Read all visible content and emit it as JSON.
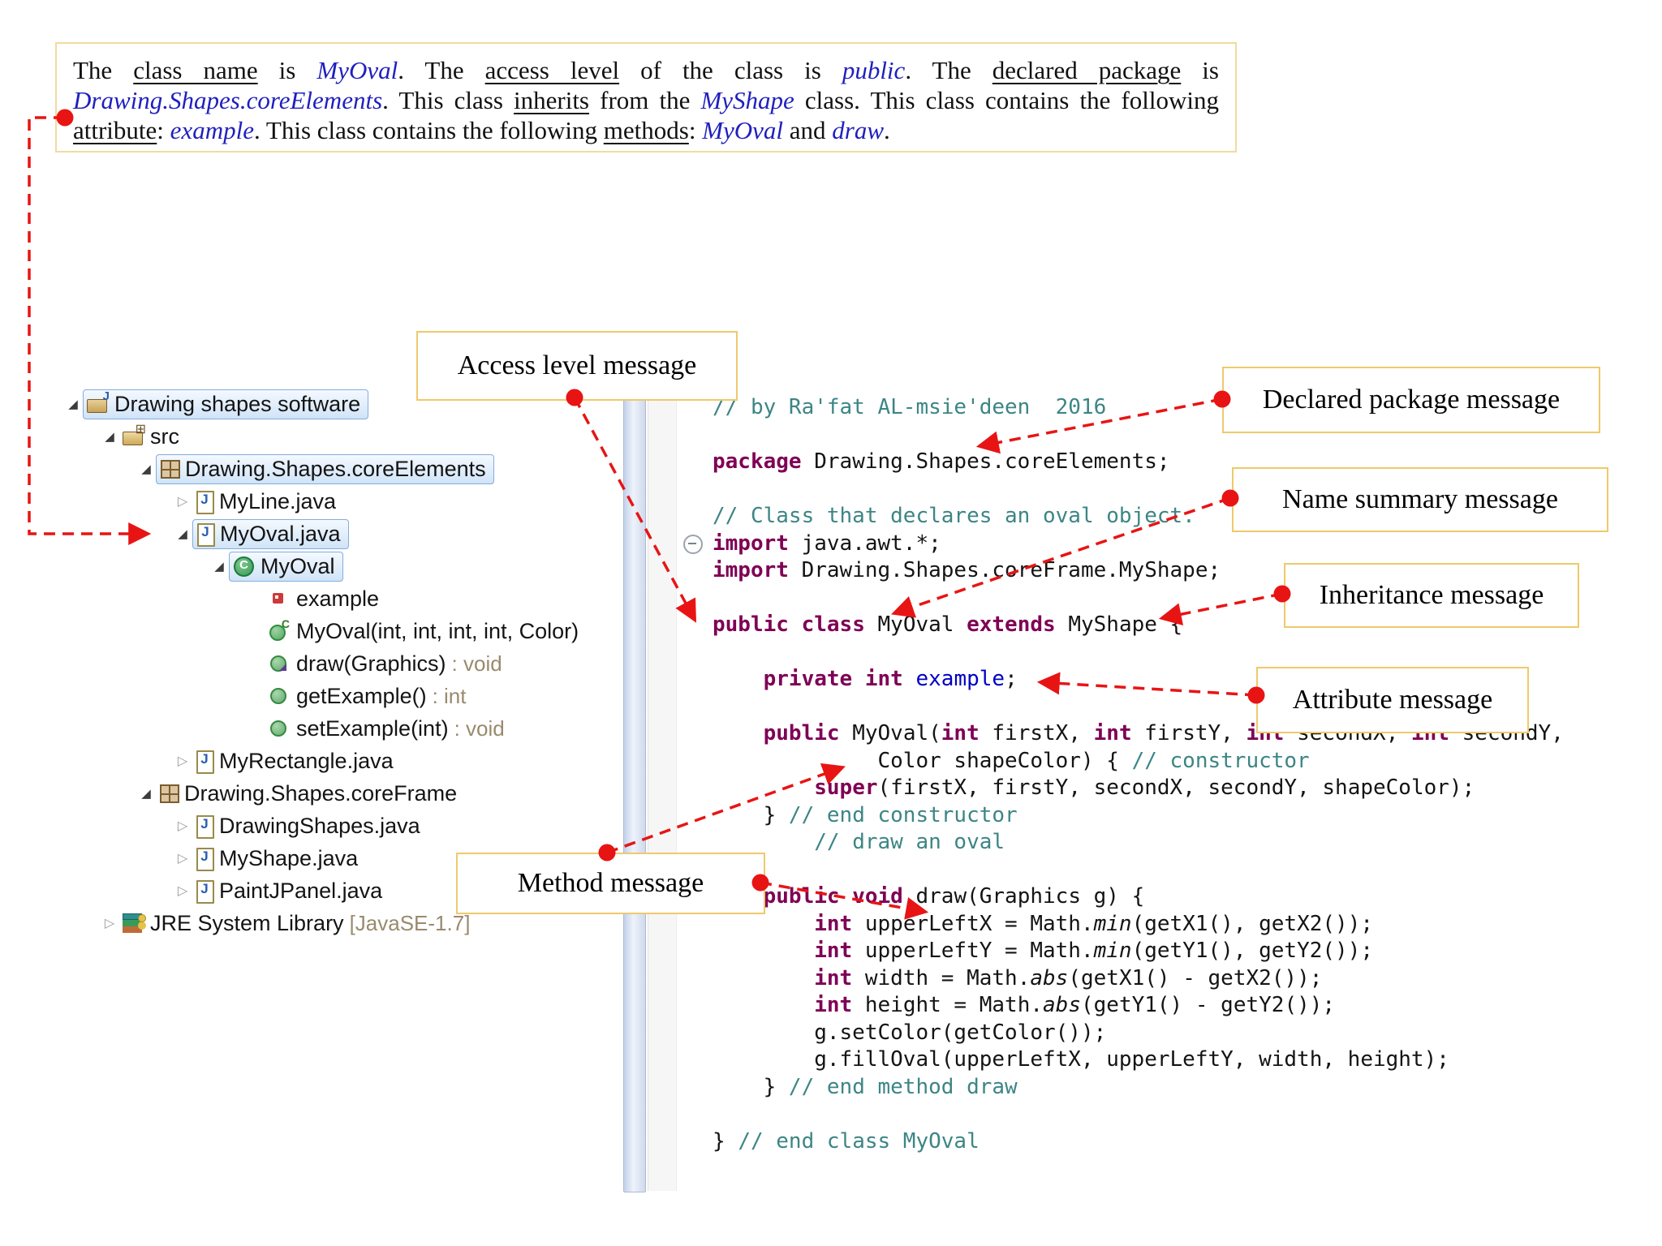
{
  "summary": {
    "segments": [
      {
        "t": "The ",
        "s": "p"
      },
      {
        "t": "class name",
        "s": "u"
      },
      {
        "t": " is ",
        "s": "p"
      },
      {
        "t": "MyOval",
        "s": "b"
      },
      {
        "t": ". The ",
        "s": "p"
      },
      {
        "t": "access level",
        "s": "u"
      },
      {
        "t": " of the class is ",
        "s": "p"
      },
      {
        "t": "public",
        "s": "b"
      },
      {
        "t": ". The ",
        "s": "p"
      },
      {
        "t": "declared package",
        "s": "u"
      },
      {
        "t": " is ",
        "s": "p"
      },
      {
        "t": "Drawing.Shapes.coreElements",
        "s": "b"
      },
      {
        "t": ". This class ",
        "s": "p"
      },
      {
        "t": "inherits",
        "s": "u"
      },
      {
        "t": " from the ",
        "s": "p"
      },
      {
        "t": "MyShape",
        "s": "b"
      },
      {
        "t": " class. This class contains the following ",
        "s": "p"
      },
      {
        "t": "attribute",
        "s": "u"
      },
      {
        "t": ": ",
        "s": "p"
      },
      {
        "t": "example",
        "s": "b"
      },
      {
        "t": ". This class contains the following ",
        "s": "p"
      },
      {
        "t": "methods",
        "s": "u"
      },
      {
        "t": ": ",
        "s": "p"
      },
      {
        "t": "MyOval",
        "s": "b"
      },
      {
        "t": " and ",
        "s": "p"
      },
      {
        "t": "draw",
        "s": "b"
      },
      {
        "t": ".",
        "s": "p"
      }
    ]
  },
  "explorer": {
    "rows": [
      {
        "level": 0,
        "arrow": "exp",
        "icon": "java-project",
        "label": "Drawing shapes software",
        "selected": true
      },
      {
        "level": 1,
        "arrow": "exp",
        "icon": "source-folder",
        "label": "src",
        "selected": false
      },
      {
        "level": 2,
        "arrow": "exp",
        "icon": "package",
        "label": "Drawing.Shapes.coreElements",
        "selected": true
      },
      {
        "level": 3,
        "arrow": "col",
        "icon": "java-file",
        "label": "MyLine.java",
        "selected": false
      },
      {
        "level": 3,
        "arrow": "exp",
        "icon": "java-file",
        "label": "MyOval.java",
        "selected": true
      },
      {
        "level": 4,
        "arrow": "exp",
        "icon": "class",
        "label": "MyOval",
        "selected": true
      },
      {
        "level": 5,
        "arrow": null,
        "icon": "private-field",
        "label": "example",
        "selected": false
      },
      {
        "level": 5,
        "arrow": null,
        "icon": "constructor",
        "label": "MyOval(int, int, int, int, Color)",
        "selected": false
      },
      {
        "level": 5,
        "arrow": null,
        "icon": "override-method",
        "label": "draw(Graphics)",
        "suffix": " : void",
        "selected": false
      },
      {
        "level": 5,
        "arrow": null,
        "icon": "method",
        "label": "getExample()",
        "suffix": " : int",
        "selected": false
      },
      {
        "level": 5,
        "arrow": null,
        "icon": "method",
        "label": "setExample(int)",
        "suffix": " : void",
        "selected": false
      },
      {
        "level": 3,
        "arrow": "col",
        "icon": "java-file",
        "label": "MyRectangle.java",
        "selected": false
      },
      {
        "level": 2,
        "arrow": "exp",
        "icon": "package",
        "label": "Drawing.Shapes.coreFrame",
        "selected": false
      },
      {
        "level": 3,
        "arrow": "col",
        "icon": "java-file",
        "label": "DrawingShapes.java",
        "selected": false
      },
      {
        "level": 3,
        "arrow": "col",
        "icon": "java-file",
        "label": "MyShape.java",
        "selected": false
      },
      {
        "level": 3,
        "arrow": "col",
        "icon": "java-file",
        "label": "PaintJPanel.java",
        "selected": false
      },
      {
        "level": 1,
        "arrow": "col",
        "icon": "jre-library",
        "label": "JRE System Library",
        "suffix": " [JavaSE-1.7]",
        "selected": false
      }
    ]
  },
  "editor": {
    "lines": [
      {
        "tokens": [
          [
            "c",
            "// by Ra'fat AL-msie'deen  2016"
          ]
        ]
      },
      {
        "tokens": []
      },
      {
        "tokens": [
          [
            "k",
            "package"
          ],
          [
            "p",
            " Drawing.Shapes.coreElements;"
          ]
        ]
      },
      {
        "tokens": []
      },
      {
        "tokens": [
          [
            "c",
            "// Class that declares an oval object."
          ]
        ]
      },
      {
        "tokens": [
          [
            "k",
            "import"
          ],
          [
            "p",
            " java.awt.*;"
          ]
        ],
        "fold": true
      },
      {
        "tokens": [
          [
            "k",
            "import"
          ],
          [
            "p",
            " Drawing.Shapes.coreFrame.MyShape;"
          ]
        ]
      },
      {
        "tokens": []
      },
      {
        "tokens": [
          [
            "k",
            "public"
          ],
          [
            "p",
            " "
          ],
          [
            "k",
            "class"
          ],
          [
            "p",
            " MyOval "
          ],
          [
            "k",
            "extends"
          ],
          [
            "p",
            " MyShape {"
          ]
        ]
      },
      {
        "tokens": []
      },
      {
        "tokens": [
          [
            "p",
            "    "
          ],
          [
            "k",
            "private"
          ],
          [
            "p",
            " "
          ],
          [
            "k",
            "int"
          ],
          [
            "p",
            " "
          ],
          [
            "f",
            "example"
          ],
          [
            "p",
            ";"
          ]
        ]
      },
      {
        "tokens": []
      },
      {
        "tokens": [
          [
            "p",
            "    "
          ],
          [
            "k",
            "public"
          ],
          [
            "p",
            " MyOval("
          ],
          [
            "k",
            "int"
          ],
          [
            "p",
            " firstX, "
          ],
          [
            "k",
            "int"
          ],
          [
            "p",
            " firstY, "
          ],
          [
            "k",
            "int"
          ],
          [
            "p",
            " secondX, "
          ],
          [
            "k",
            "int"
          ],
          [
            "p",
            " secondY,"
          ]
        ]
      },
      {
        "tokens": [
          [
            "p",
            "             Color shapeColor) { "
          ],
          [
            "c",
            "// constructor"
          ]
        ]
      },
      {
        "tokens": [
          [
            "p",
            "        "
          ],
          [
            "k",
            "super"
          ],
          [
            "p",
            "(firstX, firstY, secondX, secondY, shapeColor);"
          ]
        ]
      },
      {
        "tokens": [
          [
            "p",
            "    } "
          ],
          [
            "c",
            "// end constructor"
          ]
        ]
      },
      {
        "tokens": [
          [
            "p",
            "        "
          ],
          [
            "c",
            "// draw an oval"
          ]
        ]
      },
      {
        "tokens": []
      },
      {
        "tokens": [
          [
            "p",
            "    "
          ],
          [
            "k",
            "public"
          ],
          [
            "p",
            " "
          ],
          [
            "k",
            "void"
          ],
          [
            "p",
            " draw(Graphics g) {"
          ]
        ]
      },
      {
        "tokens": [
          [
            "p",
            "        "
          ],
          [
            "k",
            "int"
          ],
          [
            "p",
            " upperLeftX = Math."
          ],
          [
            "i",
            "min"
          ],
          [
            "p",
            "(getX1(), getX2());"
          ]
        ]
      },
      {
        "tokens": [
          [
            "p",
            "        "
          ],
          [
            "k",
            "int"
          ],
          [
            "p",
            " upperLeftY = Math."
          ],
          [
            "i",
            "min"
          ],
          [
            "p",
            "(getY1(), getY2());"
          ]
        ]
      },
      {
        "tokens": [
          [
            "p",
            "        "
          ],
          [
            "k",
            "int"
          ],
          [
            "p",
            " width = Math."
          ],
          [
            "i",
            "abs"
          ],
          [
            "p",
            "(getX1() - getX2());"
          ]
        ]
      },
      {
        "tokens": [
          [
            "p",
            "        "
          ],
          [
            "k",
            "int"
          ],
          [
            "p",
            " height = Math."
          ],
          [
            "i",
            "abs"
          ],
          [
            "p",
            "(getY1() - getY2());"
          ]
        ]
      },
      {
        "tokens": [
          [
            "p",
            "        g.setColor(getColor());"
          ]
        ]
      },
      {
        "tokens": [
          [
            "p",
            "        g.fillOval(upperLeftX, upperLeftY, width, height);"
          ]
        ]
      },
      {
        "tokens": [
          [
            "p",
            "    } "
          ],
          [
            "c",
            "// end method draw"
          ]
        ]
      },
      {
        "tokens": []
      },
      {
        "tokens": [
          [
            "p",
            "} "
          ],
          [
            "c",
            "// end class MyOval"
          ]
        ]
      }
    ]
  },
  "callouts": {
    "access": {
      "label": "Access level message"
    },
    "declared": {
      "label": "Declared package message"
    },
    "name": {
      "label": "Name summary message"
    },
    "inherit": {
      "label": "Inheritance message"
    },
    "attr": {
      "label": "Attribute message"
    },
    "method": {
      "label": "Method message"
    }
  },
  "colors": {
    "accent_red": "#E81414",
    "callout_border": "#EFC96B",
    "summary_border": "#F0DCA0",
    "keyword": "#7F0055",
    "comment": "#3D8585",
    "field": "#0000C5",
    "decorator": "#998A6E",
    "selection_border": "#84ACDD"
  }
}
